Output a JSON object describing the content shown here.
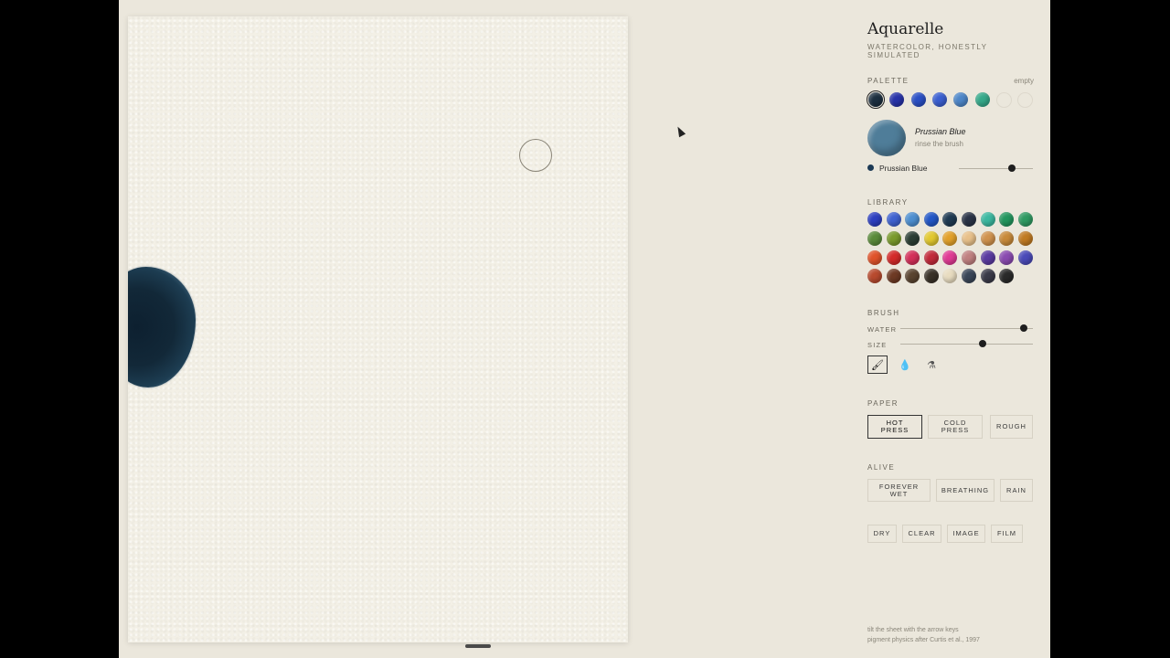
{
  "app": {
    "title": "Aquarelle",
    "subtitle": "WATERCOLOR, HONESTLY SIMULATED"
  },
  "palette": {
    "label": "PALETTE",
    "hint": "empty",
    "swatches": [
      {
        "color": "#1c2f40",
        "selected": true
      },
      {
        "color": "#2732a8"
      },
      {
        "color": "#2a4fc4"
      },
      {
        "color": "#3a5fd0"
      },
      {
        "color": "#4d86c8"
      },
      {
        "color": "#35a98a"
      },
      {
        "color": "empty"
      },
      {
        "color": "empty"
      }
    ]
  },
  "current_pigment": {
    "name": "Prussian Blue",
    "hint": "rinse the brush",
    "preview_color": "#4f7d99"
  },
  "mix": {
    "dot_color": "#1c3a55",
    "name": "Prussian Blue",
    "amount": 0.71
  },
  "library": {
    "label": "LIBRARY",
    "rows": [
      [
        "#2d3fc0",
        "#3f62d0",
        "#4e8fd0",
        "#2357c6",
        "#1f3a52",
        "#2a3447",
        "#3cb8a0",
        "#23965e",
        "#2f9a62"
      ],
      [
        "#5a8a3a",
        "#7a9a2c",
        "#2c3e34",
        "#e2c830",
        "#e2a02a",
        "#e8c08a",
        "#d0924e",
        "#c88a3a",
        "#c07a22"
      ],
      [
        "#e0532a",
        "#d42a2a",
        "#d4305a",
        "#c22a3a",
        "#e03a94",
        "#c08080",
        "#5a3aa0",
        "#8a4ab0",
        "#4a4ab8"
      ],
      [
        "#b84a2e",
        "#6e3a24",
        "#5a4430",
        "#3a3228",
        "#e8dcc0",
        "#3a4658",
        "#3a3a48",
        "#2a2a2a"
      ]
    ]
  },
  "brush": {
    "label": "BRUSH",
    "water_label": "WATER",
    "water": 0.93,
    "size_label": "SIZE",
    "size": 0.62,
    "tools": [
      {
        "name": "brush-tool",
        "icon": "brush-icon",
        "glyph": "🖌",
        "active": true
      },
      {
        "name": "drop-tool",
        "icon": "drop-outline-icon",
        "glyph": "💧"
      },
      {
        "name": "flask-tool",
        "icon": "dropper-icon",
        "glyph": "⚗"
      }
    ]
  },
  "paper": {
    "label": "PAPER",
    "options": [
      {
        "label": "HOT PRESS",
        "active": true
      },
      {
        "label": "COLD PRESS"
      },
      {
        "label": "ROUGH"
      }
    ]
  },
  "alive": {
    "label": "ALIVE",
    "options": [
      {
        "label": "FOREVER WET"
      },
      {
        "label": "BREATHING"
      },
      {
        "label": "RAIN"
      }
    ]
  },
  "actions": [
    "DRY",
    "CLEAR",
    "IMAGE",
    "FILM"
  ],
  "footer": {
    "line1": "tilt the sheet with the arrow keys",
    "line2": "pigment physics after Curtis et al., 1997"
  }
}
